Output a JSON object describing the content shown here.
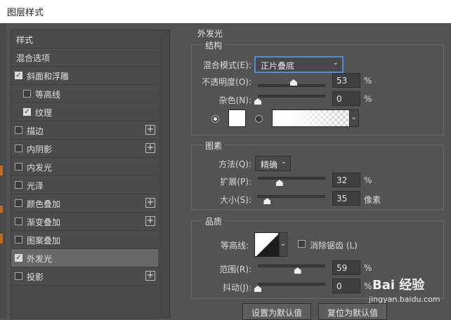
{
  "window": {
    "title": "图层样式"
  },
  "style_list": {
    "items": [
      {
        "label": "样式",
        "checkbox": false,
        "checked": false,
        "plus": false,
        "indent": 0,
        "selected": false
      },
      {
        "label": "混合选项",
        "checkbox": false,
        "checked": false,
        "plus": false,
        "indent": 0,
        "selected": false
      },
      {
        "label": "斜面和浮雕",
        "checkbox": true,
        "checked": true,
        "plus": false,
        "indent": 0,
        "selected": false
      },
      {
        "label": "等高线",
        "checkbox": true,
        "checked": false,
        "plus": false,
        "indent": 1,
        "selected": false
      },
      {
        "label": "纹理",
        "checkbox": true,
        "checked": true,
        "plus": false,
        "indent": 1,
        "selected": false
      },
      {
        "label": "描边",
        "checkbox": true,
        "checked": false,
        "plus": true,
        "indent": 0,
        "selected": false
      },
      {
        "label": "内阴影",
        "checkbox": true,
        "checked": false,
        "plus": true,
        "indent": 0,
        "selected": false
      },
      {
        "label": "内发光",
        "checkbox": true,
        "checked": false,
        "plus": false,
        "indent": 0,
        "selected": false
      },
      {
        "label": "光泽",
        "checkbox": true,
        "checked": false,
        "plus": false,
        "indent": 0,
        "selected": false
      },
      {
        "label": "颜色叠加",
        "checkbox": true,
        "checked": false,
        "plus": true,
        "indent": 0,
        "selected": false
      },
      {
        "label": "渐变叠加",
        "checkbox": true,
        "checked": false,
        "plus": true,
        "indent": 0,
        "selected": false
      },
      {
        "label": "图案叠加",
        "checkbox": true,
        "checked": false,
        "plus": false,
        "indent": 0,
        "selected": false
      },
      {
        "label": "外发光",
        "checkbox": true,
        "checked": true,
        "plus": false,
        "indent": 0,
        "selected": true
      },
      {
        "label": "投影",
        "checkbox": true,
        "checked": false,
        "plus": true,
        "indent": 0,
        "selected": false
      }
    ]
  },
  "outer_glow": {
    "title": "外发光",
    "structure": {
      "title": "结构",
      "blend_mode": {
        "label": "混合模式(E):",
        "value": "正片叠底"
      },
      "opacity": {
        "label": "不透明度(O):",
        "value": "53",
        "unit": "%",
        "level": 0.53
      },
      "noise": {
        "label": "杂色(N):",
        "value": "0",
        "unit": "%",
        "level": 0
      },
      "fill_mode": "color",
      "color": "#ffffff"
    },
    "elements": {
      "title": "图素",
      "technique": {
        "label": "方法(Q):",
        "value": "精确"
      },
      "spread": {
        "label": "扩展(P):",
        "value": "32",
        "unit": "%",
        "level": 0.32
      },
      "size": {
        "label": "大小(S):",
        "value": "35",
        "unit": "像素",
        "level": 0.14
      }
    },
    "quality": {
      "title": "品质",
      "contour_label": "等高线:",
      "anti_alias": {
        "label": "消除锯齿 (L)",
        "checked": false
      },
      "range": {
        "label": "范围(R):",
        "value": "59",
        "unit": "%",
        "level": 0.59
      },
      "jitter": {
        "label": "抖动(J):",
        "value": "0",
        "unit": "%",
        "level": 0
      }
    },
    "buttons": {
      "make_default": "设置为默认值",
      "reset_default": "复位为默认值"
    }
  },
  "watermark": {
    "brand": "Bai 经验",
    "url": "jingyan.baidu.com"
  }
}
